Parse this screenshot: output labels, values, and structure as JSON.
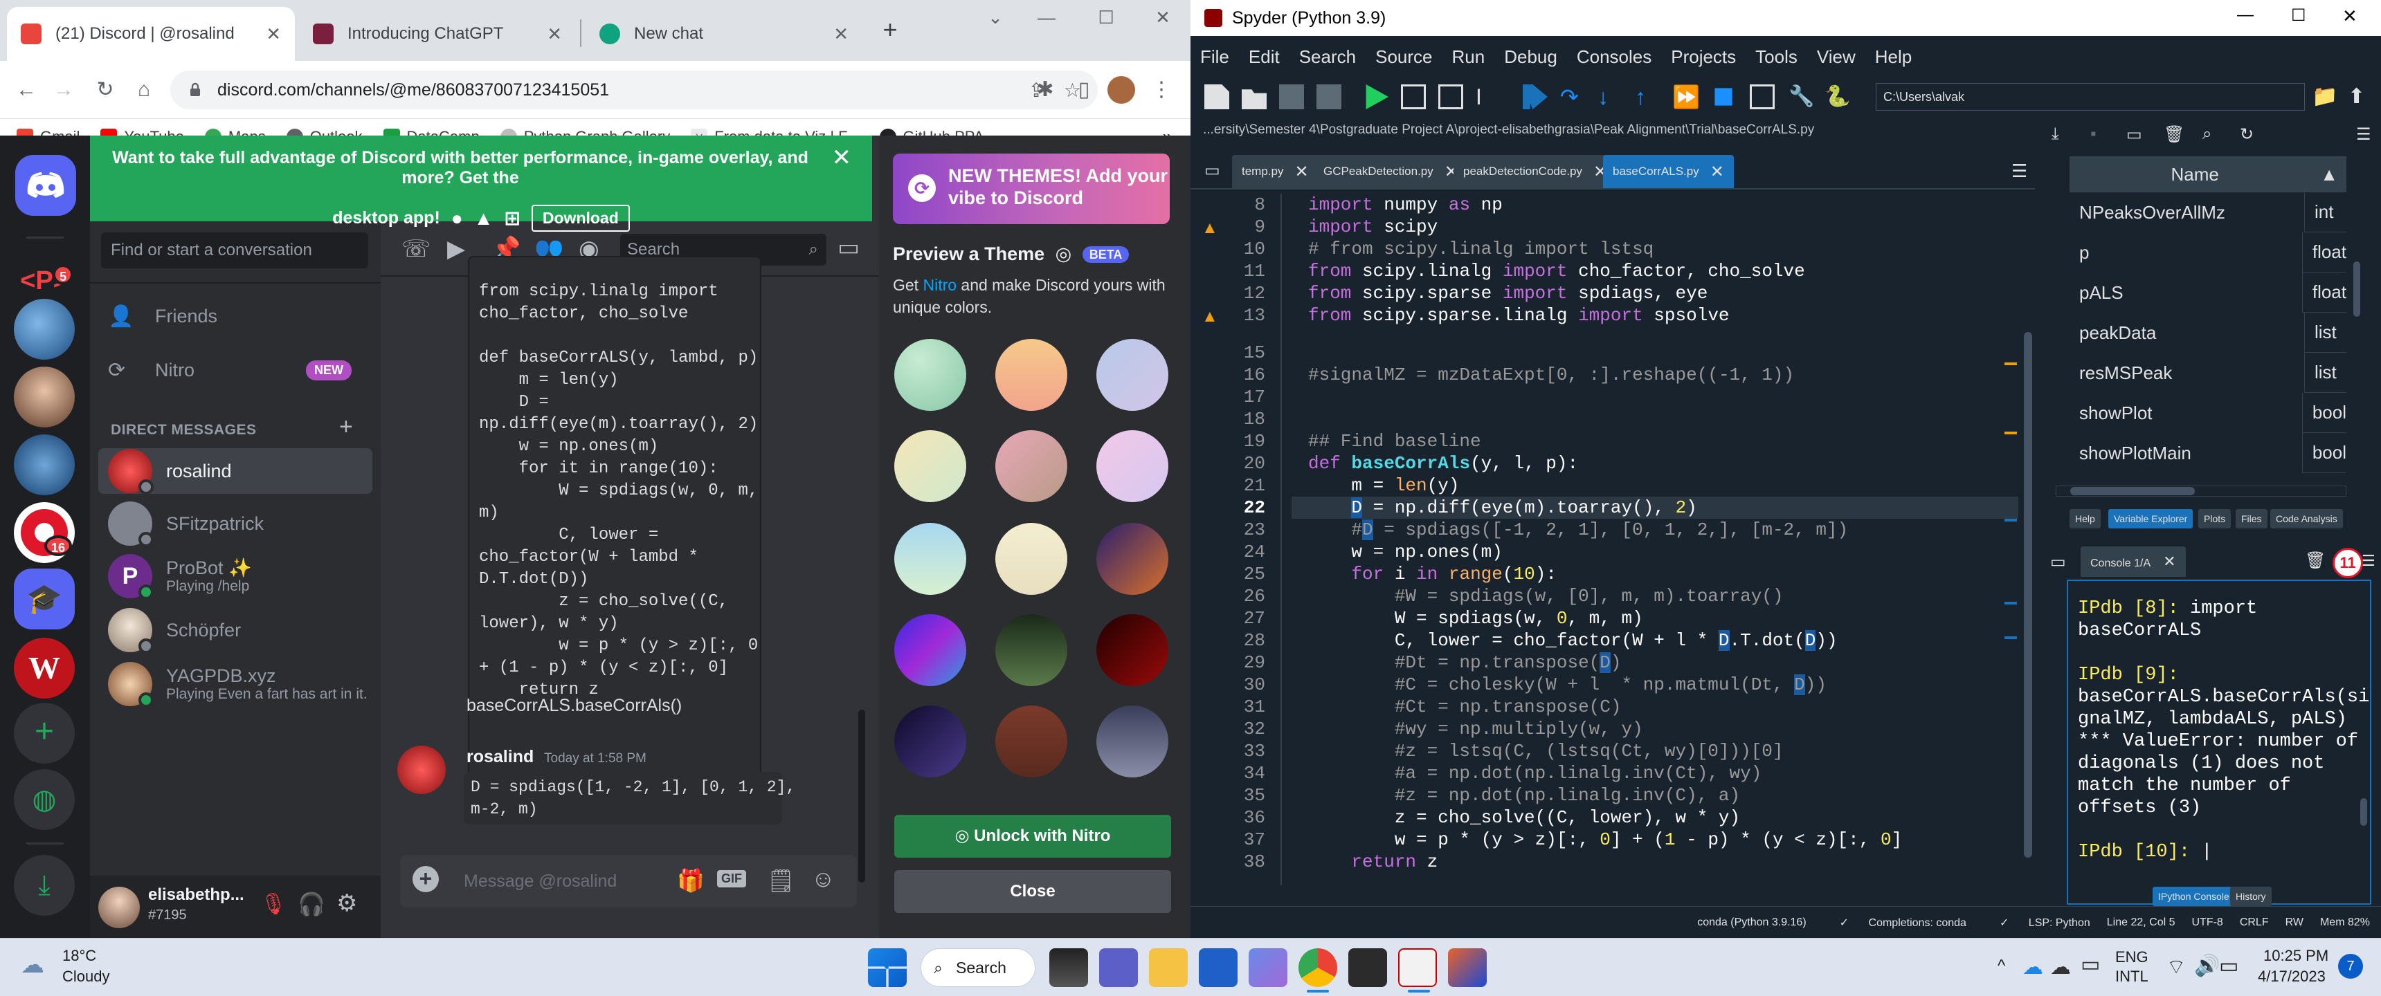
{
  "chrome": {
    "tabs": [
      {
        "title": "(21) Discord | @rosalind",
        "active": true
      },
      {
        "title": "Introducing ChatGPT",
        "active": false
      },
      {
        "title": "New chat",
        "active": false
      }
    ],
    "url": "discord.com/channels/@me/860837007123415051",
    "bookmarks": [
      "Gmail",
      "YouTube",
      "Maps",
      "Outlook",
      "DataCamp",
      "Python Graph Gallery",
      "From data to Viz | F...",
      "GitHub PPA"
    ],
    "more": "»"
  },
  "discord": {
    "banner_text": "Want to take full advantage of Discord with better performance, in-game overlay, and more? Get the",
    "banner_text2": "desktop app!",
    "download_label": "Download",
    "search_placeholder": "Find or start a conversation",
    "friends_label": "Friends",
    "nitro_label": "Nitro",
    "new_badge": "NEW",
    "dm_header": "DIRECT MESSAGES",
    "dm_add": "+",
    "guild_badges": [
      "5",
      "16"
    ],
    "dms": [
      {
        "name": "rosalind",
        "sub": ""
      },
      {
        "name": "SFitzpatrick",
        "sub": ""
      },
      {
        "name": "ProBot ✨",
        "sub": "Playing /help"
      },
      {
        "name": "Schöpfer",
        "sub": ""
      },
      {
        "name": "YAGPDB.xyz",
        "sub": "Playing Even a fart has art in it."
      }
    ],
    "user": {
      "name": "elisabethp...",
      "tag": "#7195"
    },
    "chat_search": "Search",
    "code_block": "from scipy.linalg import\ncho_factor, cho_solve\n\ndef baseCorrALS(y, lambd, p):\n    m = len(y)\n    D =\nnp.diff(eye(m).toarray(), 2)\n    w = np.ones(m)\n    for it in range(10):\n        W = spdiags(w, 0, m,\nm)\n        C, lower =\ncho_factor(W + lambd *\nD.T.dot(D))\n        z = cho_solve((C,\nlower), w * y)\n        w = p * (y > z)[:, 0]\n+ (1 - p) * (y < z)[:, 0]\n    return z",
    "after_code": "baseCorrALS.baseCorrAls()",
    "message": {
      "author": "rosalind",
      "time": "Today at 1:58 PM",
      "code": "D = spdiags([1, -2, 1], [0, 1, 2],\nm-2, m)"
    },
    "composer_placeholder": "Message @rosalind",
    "gif_label": "GIF",
    "themes": {
      "promo_title": "NEW THEMES! Add your vibe to Discord",
      "preview_title": "Preview a Theme",
      "beta": "BETA",
      "desc_pre": "Get ",
      "desc_link": "Nitro",
      "desc_post": " and make Discord yours with unique colors.",
      "unlock_label": "Unlock with Nitro",
      "close_label": "Close"
    }
  },
  "spyder": {
    "title": "Spyder (Python 3.9)",
    "menu": [
      "File",
      "Edit",
      "Search",
      "Source",
      "Run",
      "Debug",
      "Consoles",
      "Projects",
      "Tools",
      "View",
      "Help"
    ],
    "cwd": "C:\\Users\\alvak",
    "path": "...ersity\\Semester 4\\Postgraduate Project A\\project-elisabethgrasia\\Peak Alignment\\Trial\\baseCorrALS.py",
    "editor_tabs": [
      "temp.py",
      "GCPeakDetection.py",
      "peakDetectionCode.py",
      "baseCorrALS.py"
    ],
    "line_numbers": [
      "8",
      "9",
      "10",
      "11",
      "12",
      "13",
      "15",
      "16",
      "17",
      "18",
      "19",
      "20",
      "21",
      "22",
      "23",
      "24",
      "25",
      "26",
      "27",
      "28",
      "29",
      "30",
      "31",
      "32",
      "33",
      "34",
      "35",
      "36",
      "37",
      "38"
    ],
    "current_line": "22",
    "variables": {
      "header": "Name",
      "rows": [
        {
          "name": "NPeaksOverAllMz",
          "type": "int"
        },
        {
          "name": "p",
          "type": "float"
        },
        {
          "name": "pALS",
          "type": "float"
        },
        {
          "name": "peakData",
          "type": "list"
        },
        {
          "name": "resMSPeak",
          "type": "list"
        },
        {
          "name": "showPlot",
          "type": "bool"
        },
        {
          "name": "showPlotMain",
          "type": "bool"
        }
      ],
      "pane_tabs": [
        "Help",
        "Variable Explorer",
        "Plots",
        "Files",
        "Code Analysis"
      ]
    },
    "console": {
      "tab": "Console 1/A",
      "badge": "11",
      "lines": [
        {
          "prompt": "IPdb [8]:",
          "text": " import"
        },
        {
          "prompt": "",
          "text": "baseCorrALS"
        },
        {
          "prompt": "",
          "text": ""
        },
        {
          "prompt": "IPdb [9]:",
          "text": ""
        },
        {
          "prompt": "",
          "text": "baseCorrALS.baseCorrAls(si"
        },
        {
          "prompt": "",
          "text": "gnalMZ, lambdaALS, pALS)"
        },
        {
          "prompt": "",
          "text": "*** ValueError: number of"
        },
        {
          "prompt": "",
          "text": "diagonals (1) does not"
        },
        {
          "prompt": "",
          "text": "match the number of"
        },
        {
          "prompt": "",
          "text": "offsets (3)"
        },
        {
          "prompt": "",
          "text": ""
        },
        {
          "prompt": "IPdb [10]:",
          "text": " |"
        }
      ],
      "bottom_tabs": [
        "IPython Console",
        "History"
      ]
    },
    "status": [
      "conda (Python 3.9.16)",
      "Completions: conda",
      "LSP: Python",
      "Line 22, Col 5",
      "UTF-8",
      "CRLF",
      "RW",
      "Mem 82%"
    ]
  },
  "taskbar": {
    "weather_temp": "18°C",
    "weather_desc": "Cloudy",
    "search_label": "Search",
    "lang1": "ENG",
    "lang2": "INTL",
    "time": "10:25 PM",
    "date": "4/17/2023",
    "notif": "7"
  }
}
